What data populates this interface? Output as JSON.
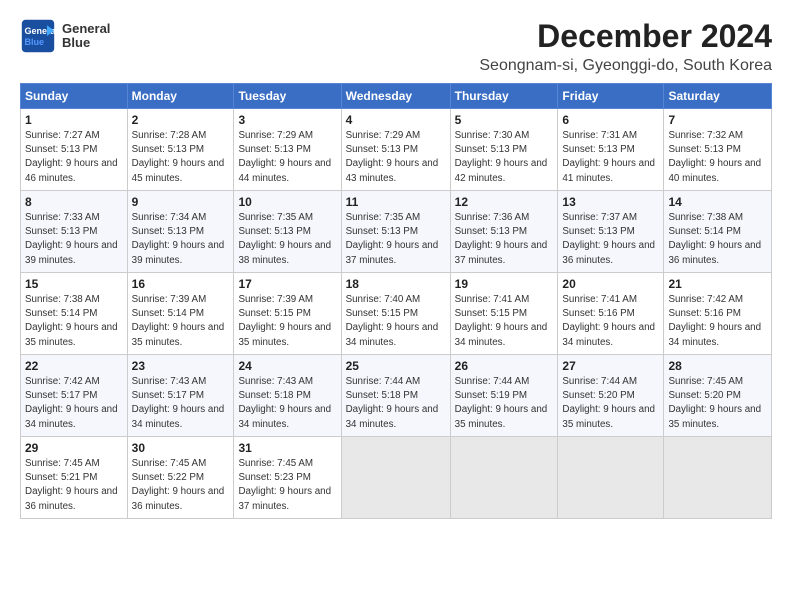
{
  "logo": {
    "line1": "General",
    "line2": "Blue"
  },
  "title": "December 2024",
  "subtitle": "Seongnam-si, Gyeonggi-do, South Korea",
  "headers": [
    "Sunday",
    "Monday",
    "Tuesday",
    "Wednesday",
    "Thursday",
    "Friday",
    "Saturday"
  ],
  "weeks": [
    [
      {
        "day": "1",
        "sunrise": "7:27 AM",
        "sunset": "5:13 PM",
        "daylight": "9 hours and 46 minutes."
      },
      {
        "day": "2",
        "sunrise": "7:28 AM",
        "sunset": "5:13 PM",
        "daylight": "9 hours and 45 minutes."
      },
      {
        "day": "3",
        "sunrise": "7:29 AM",
        "sunset": "5:13 PM",
        "daylight": "9 hours and 44 minutes."
      },
      {
        "day": "4",
        "sunrise": "7:29 AM",
        "sunset": "5:13 PM",
        "daylight": "9 hours and 43 minutes."
      },
      {
        "day": "5",
        "sunrise": "7:30 AM",
        "sunset": "5:13 PM",
        "daylight": "9 hours and 42 minutes."
      },
      {
        "day": "6",
        "sunrise": "7:31 AM",
        "sunset": "5:13 PM",
        "daylight": "9 hours and 41 minutes."
      },
      {
        "day": "7",
        "sunrise": "7:32 AM",
        "sunset": "5:13 PM",
        "daylight": "9 hours and 40 minutes."
      }
    ],
    [
      {
        "day": "8",
        "sunrise": "7:33 AM",
        "sunset": "5:13 PM",
        "daylight": "9 hours and 39 minutes."
      },
      {
        "day": "9",
        "sunrise": "7:34 AM",
        "sunset": "5:13 PM",
        "daylight": "9 hours and 39 minutes."
      },
      {
        "day": "10",
        "sunrise": "7:35 AM",
        "sunset": "5:13 PM",
        "daylight": "9 hours and 38 minutes."
      },
      {
        "day": "11",
        "sunrise": "7:35 AM",
        "sunset": "5:13 PM",
        "daylight": "9 hours and 37 minutes."
      },
      {
        "day": "12",
        "sunrise": "7:36 AM",
        "sunset": "5:13 PM",
        "daylight": "9 hours and 37 minutes."
      },
      {
        "day": "13",
        "sunrise": "7:37 AM",
        "sunset": "5:13 PM",
        "daylight": "9 hours and 36 minutes."
      },
      {
        "day": "14",
        "sunrise": "7:38 AM",
        "sunset": "5:14 PM",
        "daylight": "9 hours and 36 minutes."
      }
    ],
    [
      {
        "day": "15",
        "sunrise": "7:38 AM",
        "sunset": "5:14 PM",
        "daylight": "9 hours and 35 minutes."
      },
      {
        "day": "16",
        "sunrise": "7:39 AM",
        "sunset": "5:14 PM",
        "daylight": "9 hours and 35 minutes."
      },
      {
        "day": "17",
        "sunrise": "7:39 AM",
        "sunset": "5:15 PM",
        "daylight": "9 hours and 35 minutes."
      },
      {
        "day": "18",
        "sunrise": "7:40 AM",
        "sunset": "5:15 PM",
        "daylight": "9 hours and 34 minutes."
      },
      {
        "day": "19",
        "sunrise": "7:41 AM",
        "sunset": "5:15 PM",
        "daylight": "9 hours and 34 minutes."
      },
      {
        "day": "20",
        "sunrise": "7:41 AM",
        "sunset": "5:16 PM",
        "daylight": "9 hours and 34 minutes."
      },
      {
        "day": "21",
        "sunrise": "7:42 AM",
        "sunset": "5:16 PM",
        "daylight": "9 hours and 34 minutes."
      }
    ],
    [
      {
        "day": "22",
        "sunrise": "7:42 AM",
        "sunset": "5:17 PM",
        "daylight": "9 hours and 34 minutes."
      },
      {
        "day": "23",
        "sunrise": "7:43 AM",
        "sunset": "5:17 PM",
        "daylight": "9 hours and 34 minutes."
      },
      {
        "day": "24",
        "sunrise": "7:43 AM",
        "sunset": "5:18 PM",
        "daylight": "9 hours and 34 minutes."
      },
      {
        "day": "25",
        "sunrise": "7:44 AM",
        "sunset": "5:18 PM",
        "daylight": "9 hours and 34 minutes."
      },
      {
        "day": "26",
        "sunrise": "7:44 AM",
        "sunset": "5:19 PM",
        "daylight": "9 hours and 35 minutes."
      },
      {
        "day": "27",
        "sunrise": "7:44 AM",
        "sunset": "5:20 PM",
        "daylight": "9 hours and 35 minutes."
      },
      {
        "day": "28",
        "sunrise": "7:45 AM",
        "sunset": "5:20 PM",
        "daylight": "9 hours and 35 minutes."
      }
    ],
    [
      {
        "day": "29",
        "sunrise": "7:45 AM",
        "sunset": "5:21 PM",
        "daylight": "9 hours and 36 minutes."
      },
      {
        "day": "30",
        "sunrise": "7:45 AM",
        "sunset": "5:22 PM",
        "daylight": "9 hours and 36 minutes."
      },
      {
        "day": "31",
        "sunrise": "7:45 AM",
        "sunset": "5:23 PM",
        "daylight": "9 hours and 37 minutes."
      },
      null,
      null,
      null,
      null
    ]
  ]
}
